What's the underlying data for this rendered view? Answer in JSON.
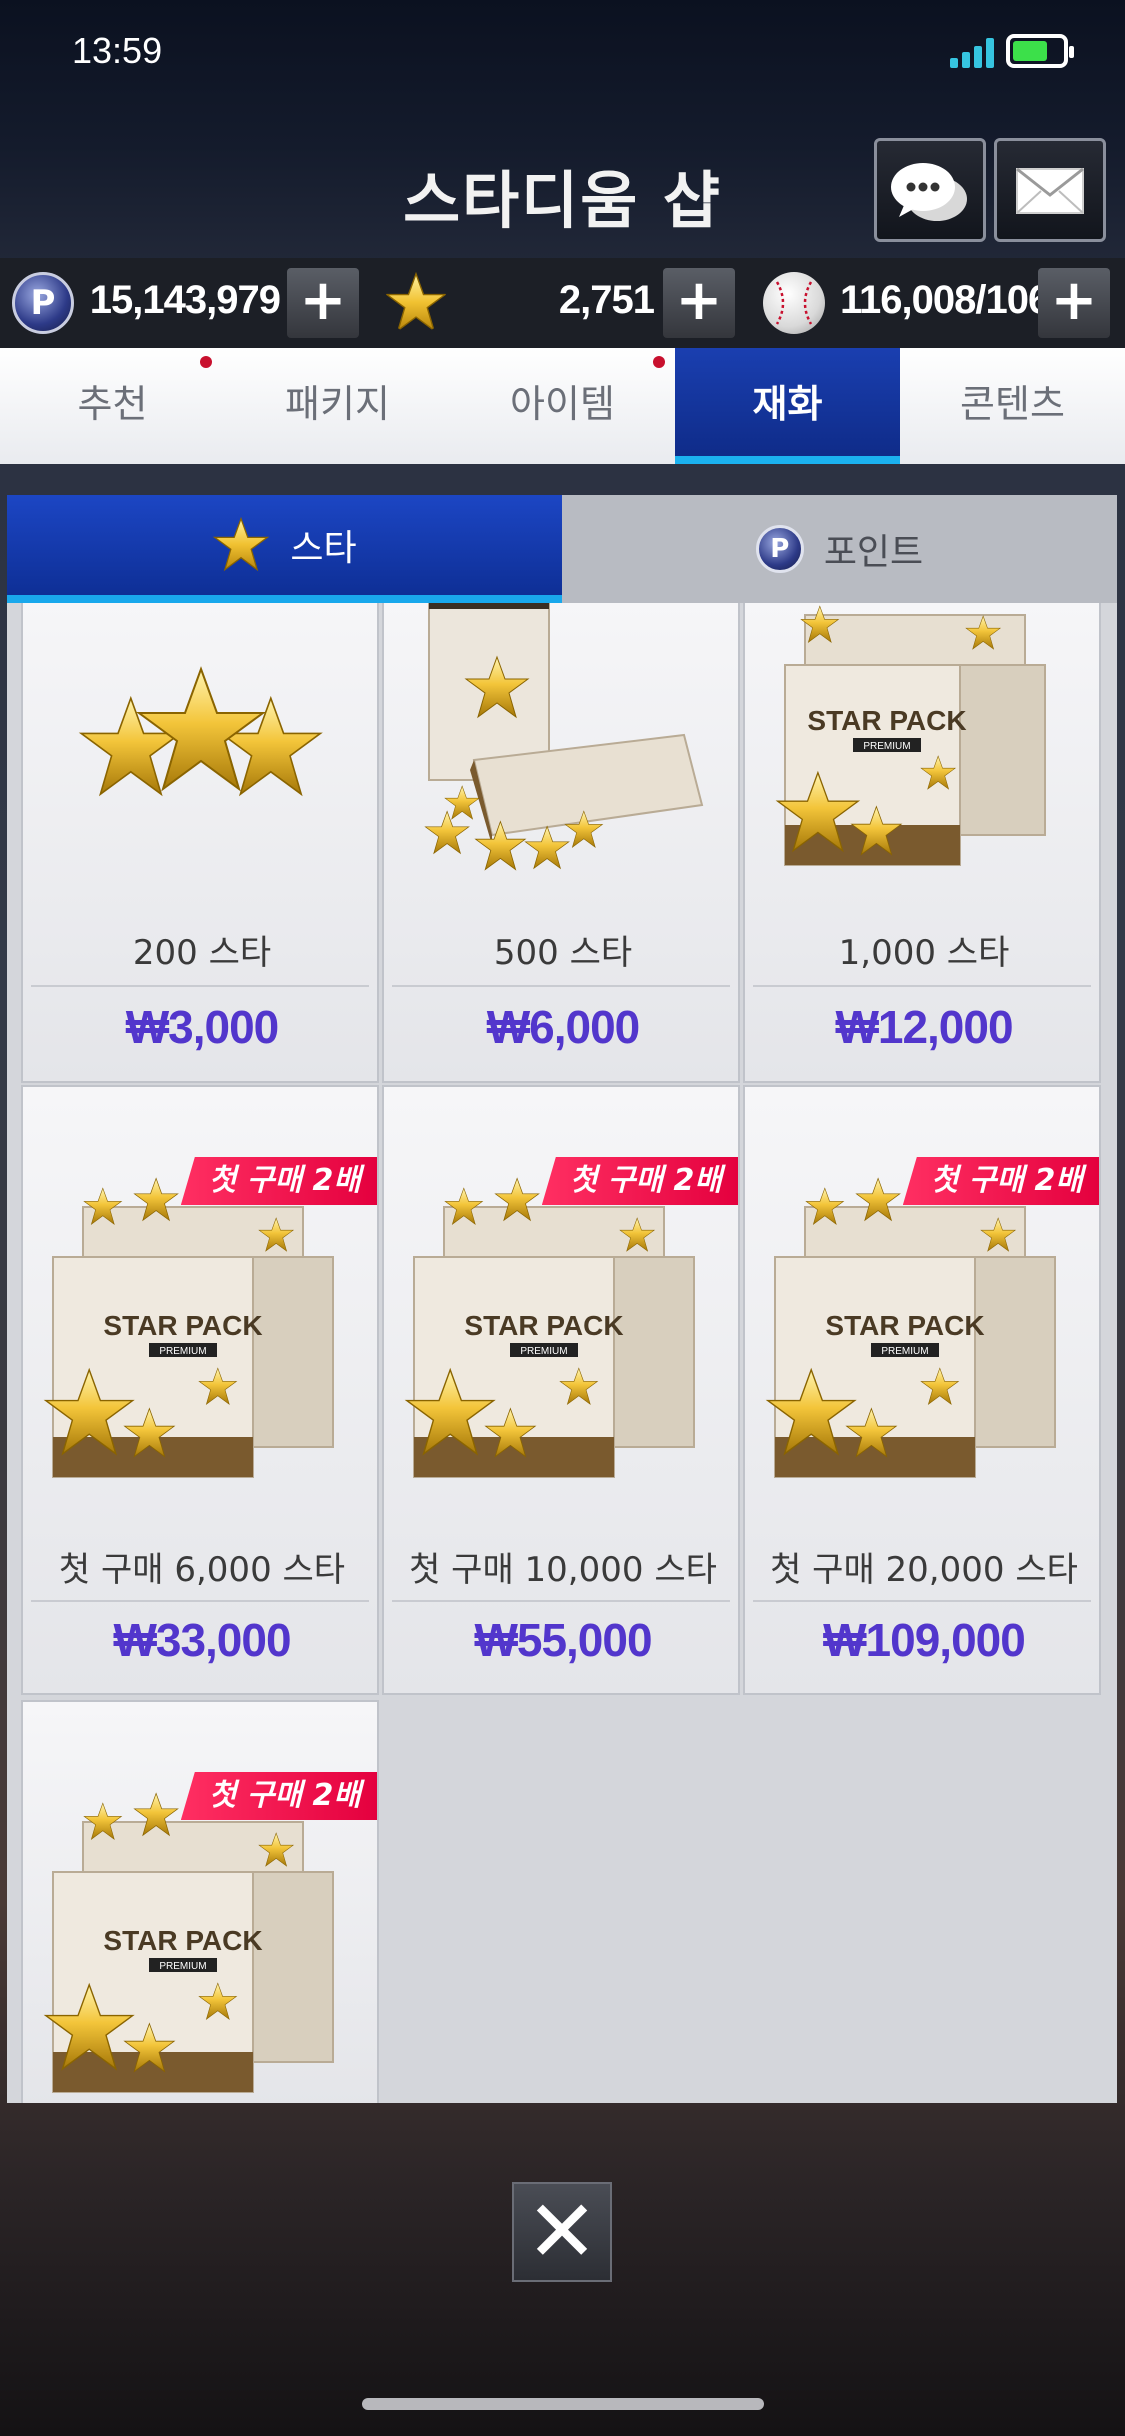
{
  "status": {
    "time": "13:59"
  },
  "header": {
    "title": "스타디움 샵"
  },
  "currency": {
    "points": "15,143,979",
    "stars": "2,751",
    "balls": "116,008/106"
  },
  "tabs": [
    {
      "label": "추천",
      "dot": true
    },
    {
      "label": "패키지",
      "dot": false
    },
    {
      "label": "아이템",
      "dot": true
    },
    {
      "label": "재화",
      "dot": false,
      "active": true
    },
    {
      "label": "콘텐츠",
      "dot": false
    }
  ],
  "subtabs": [
    {
      "label": "스타",
      "icon": "star-icon",
      "active": true
    },
    {
      "label": "포인트",
      "icon": "point-coin-icon",
      "active": false
    }
  ],
  "products": [
    {
      "name": "200 스타",
      "price": "₩3,000",
      "image": "star-cluster-icon",
      "badge": ""
    },
    {
      "name": "500 스타",
      "price": "₩6,000",
      "image": "star-pack-box-icon",
      "badge": ""
    },
    {
      "name": "1,000 스타",
      "price": "₩12,000",
      "image": "star-pack-premium-icon",
      "badge": ""
    },
    {
      "name": "첫 구매 6,000 스타",
      "price": "₩33,000",
      "image": "star-pack-premium-icon",
      "badge": "첫 구매 2배"
    },
    {
      "name": "첫 구매 10,000 스타",
      "price": "₩55,000",
      "image": "star-pack-premium-icon",
      "badge": "첫 구매 2배"
    },
    {
      "name": "첫 구매 20,000 스타",
      "price": "₩109,000",
      "image": "star-pack-premium-icon",
      "badge": "첫 구매 2배"
    },
    {
      "name": "",
      "price": "",
      "image": "star-pack-premium-icon",
      "badge": "첫 구매 2배"
    }
  ],
  "pack_label": {
    "line1": "STAR PACK",
    "line2": "PREMIUM"
  },
  "colors": {
    "accent": "#0e2f96",
    "price": "#5236cc",
    "badge": "#e4003e",
    "highlight": "#19a8ec"
  }
}
